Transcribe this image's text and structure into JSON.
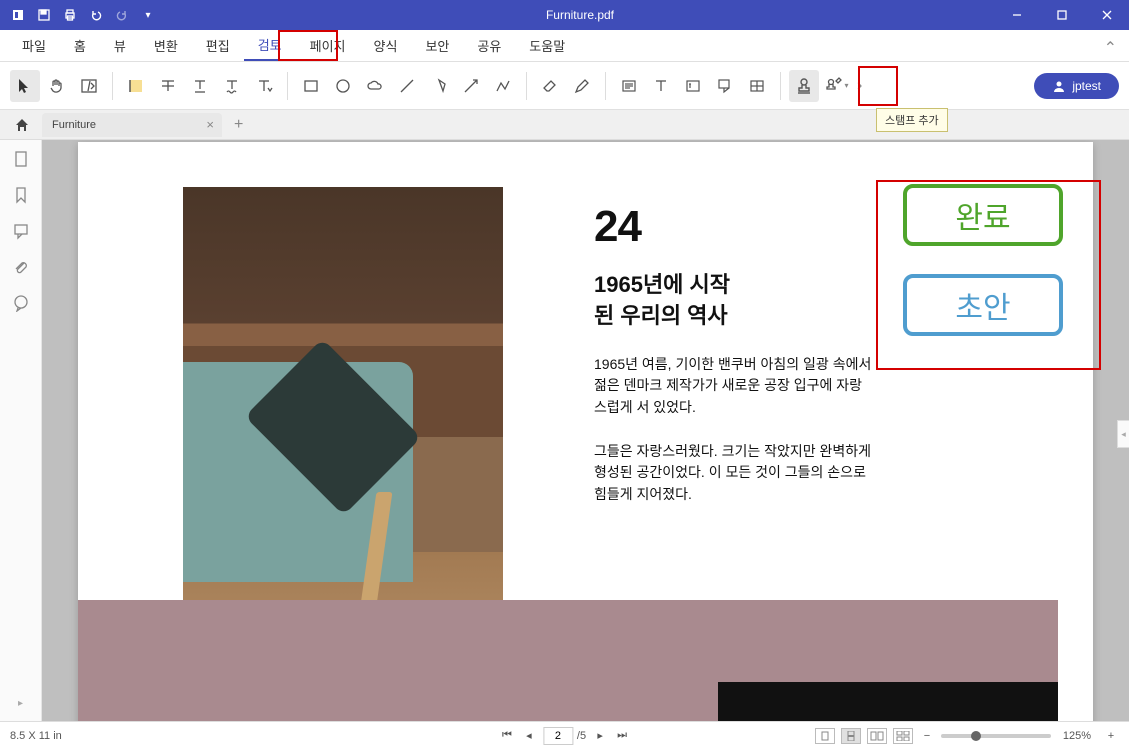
{
  "titlebar": {
    "title": "Furniture.pdf"
  },
  "menu": {
    "items": [
      "파일",
      "홈",
      "뷰",
      "변환",
      "편집",
      "검토",
      "페이지",
      "양식",
      "보안",
      "공유",
      "도움말"
    ],
    "active_index": 5
  },
  "toolbar": {
    "tooltip": "스탬프 추가",
    "user_label": "jptest"
  },
  "tab": {
    "doc_name": "Furniture"
  },
  "page": {
    "big_number": "24",
    "headline_line1": "1965년에 시작",
    "headline_line2": "된 우리의 역사",
    "para1": "1965년 여름, 기이한 밴쿠버 아침의 일광 속에서 젊은 덴마크 제작가가 새로운 공장 입구에 자랑스럽게 서 있었다.",
    "para2": "그들은 자랑스러웠다. 크기는 작았지만 완벽하게 형성된 공간이었다. 이 모든 것이 그들의 손으로 힘들게 지어졌다.",
    "stamp_green": "완료",
    "stamp_blue": "초안"
  },
  "status": {
    "page_size": "8.5 X 11 in",
    "page_current": "2",
    "page_total": "/5",
    "zoom": "125%"
  }
}
